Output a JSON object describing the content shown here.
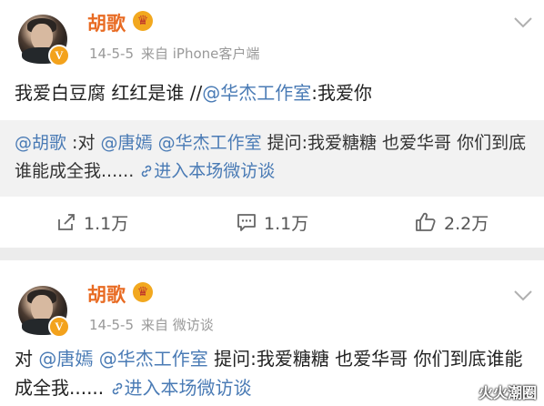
{
  "posts": [
    {
      "author": "胡歌",
      "date": "14-5-5",
      "source": "来自 iPhone客户端",
      "text_plain": "我爱白豆腐 红红是谁 //",
      "text_mention": "@华杰工作室",
      "text_tail": ":我爱你",
      "quote": {
        "author_mention": "@胡歌",
        "text1": " :对 ",
        "mention1": "@唐嫣",
        "space": " ",
        "mention2": "@华杰工作室",
        "text2": " 提问:我爱糖糖 也爱华哥 你们到底谁能成全我......",
        "link": "进入本场微访谈"
      },
      "actions": {
        "repost": "1.1万",
        "comment": "1.1万",
        "like": "2.2万"
      }
    },
    {
      "author": "胡歌",
      "date": "14-5-5",
      "source": "来自 微访谈",
      "text_pre": "对 ",
      "mention1": "@唐嫣",
      "space": " ",
      "mention2": "@华杰工作室",
      "text_mid": " 提问:我爱糖糖 也爱华哥 你们到底谁能成全我......",
      "link": "进入本场微访谈"
    }
  ],
  "watermark": "火火潮圈",
  "icons": {
    "verified": "v-badge-icon",
    "crown": "crown-icon",
    "more": "chevron-down-icon",
    "link": "link-icon",
    "repost": "repost-icon",
    "comment": "comment-icon",
    "like": "thumbs-up-icon"
  },
  "colors": {
    "name": "#e86b23",
    "mention": "#4a7bb5",
    "meta": "#999999",
    "quote_bg": "#f2f2f2",
    "divider": "#ececec"
  }
}
